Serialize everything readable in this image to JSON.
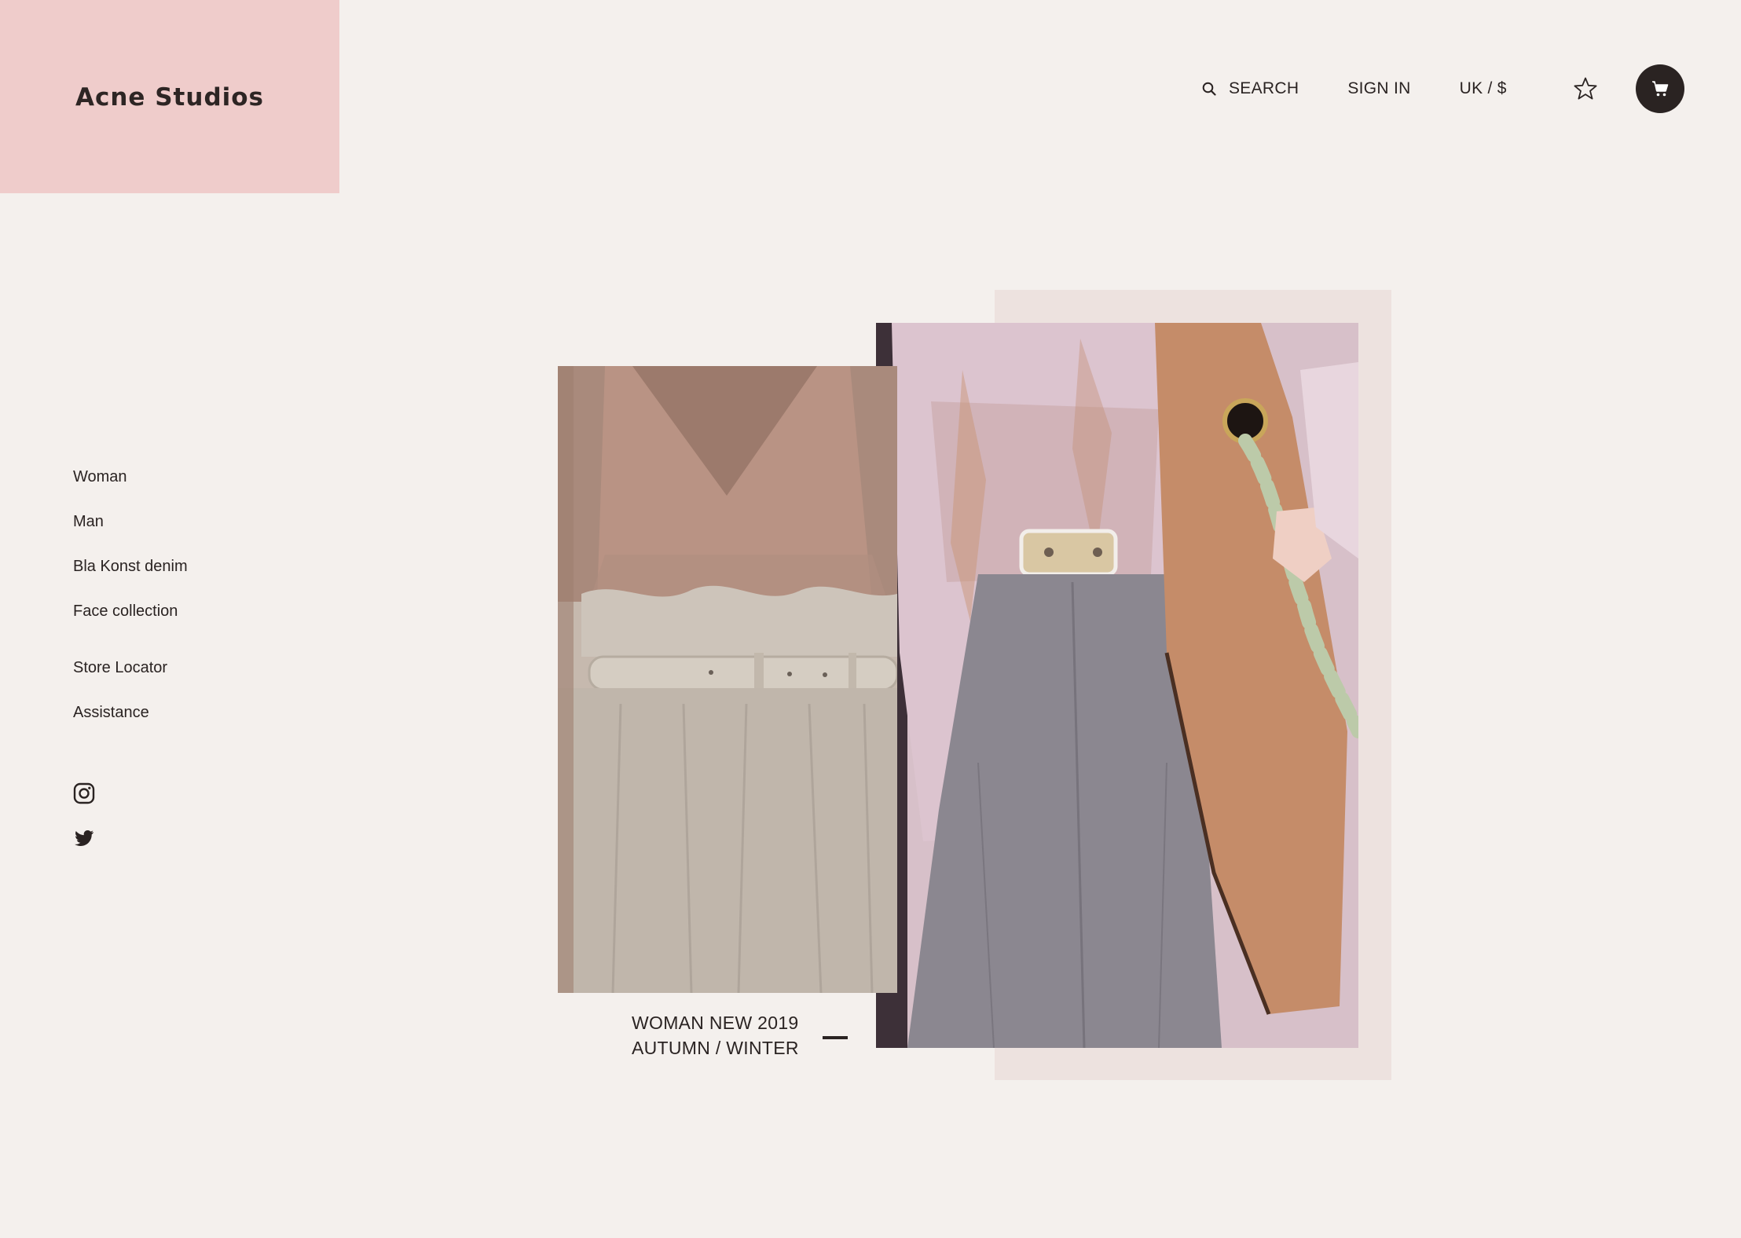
{
  "brand": {
    "name": "Acne Studios",
    "color": "#efcccb"
  },
  "header": {
    "search_label": "SEARCH",
    "signin_label": "SIGN IN",
    "locale_label": "UK / $",
    "wishlist_icon": "star-icon",
    "cart_icon": "cart-icon"
  },
  "sidebar": {
    "items": [
      {
        "label": "Woman"
      },
      {
        "label": "Man"
      },
      {
        "label": "Bla Konst denim"
      },
      {
        "label": "Face collection"
      }
    ],
    "secondary": [
      {
        "label": "Store Locator"
      },
      {
        "label": "Assistance"
      }
    ],
    "social": [
      "instagram-icon",
      "twitter-icon"
    ]
  },
  "hero": {
    "caption_line1": "WOMAN NEW 2019",
    "caption_line2": "AUTUMN / WINTER"
  },
  "colors": {
    "background": "#f4f0ed",
    "panel": "#ede2df",
    "text": "#2a2322"
  }
}
